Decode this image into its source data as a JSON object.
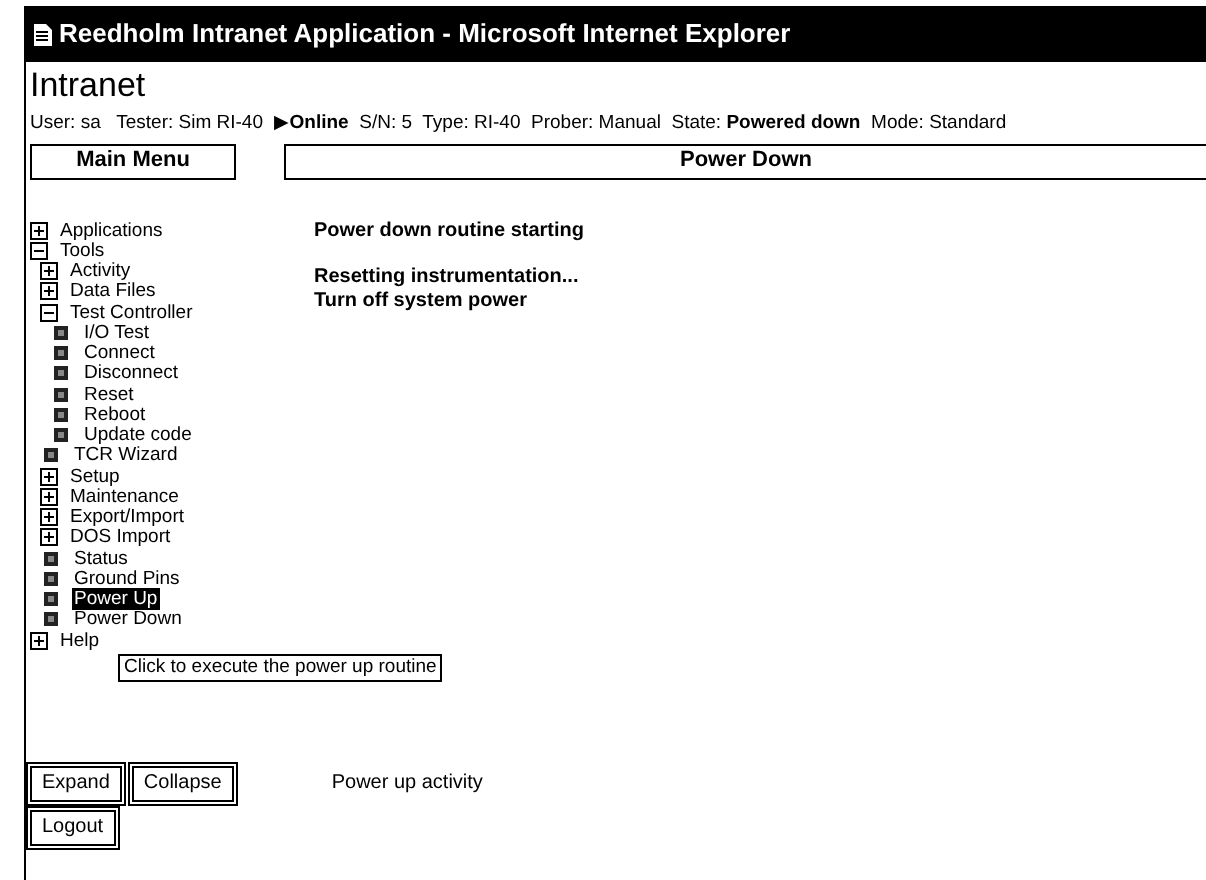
{
  "window": {
    "title": "Reedholm Intranet Application - Microsoft Internet Explorer"
  },
  "header": {
    "title": "Intranet",
    "info": "User: sa   Tester: Sim RI-40  ▶**Online**  S/N: 5  Type: RI-40  Prober: Manual  State: **Powered down**  Mode: Standard"
  },
  "menu_button": "Main Menu",
  "panel_title": "Power Down",
  "tree": [
    {
      "label": "Applications",
      "kind": "folder",
      "expanded": false,
      "selected": false
    },
    {
      "label": "Tools",
      "kind": "folder",
      "expanded": true,
      "selected": false,
      "children": [
        {
          "label": "Activity",
          "kind": "folder",
          "expanded": false,
          "selected": false
        },
        {
          "label": "Data Files",
          "kind": "folder",
          "expanded": false,
          "selected": false
        },
        {
          "label": "Test Controller",
          "kind": "folder",
          "expanded": true,
          "selected": false,
          "children": [
            {
              "label": "I/O Test",
              "kind": "leaf",
              "selected": false
            },
            {
              "label": "Connect",
              "kind": "leaf",
              "selected": false
            },
            {
              "label": "Disconnect",
              "kind": "leaf",
              "selected": false
            },
            {
              "label": "Reset",
              "kind": "leaf",
              "selected": false
            },
            {
              "label": "Reboot",
              "kind": "leaf",
              "selected": false
            },
            {
              "label": "Update code",
              "kind": "leaf",
              "selected": false
            }
          ]
        },
        {
          "label": "TCR Wizard",
          "kind": "leaf",
          "selected": false
        },
        {
          "label": "Setup",
          "kind": "folder",
          "expanded": false,
          "selected": false
        },
        {
          "label": "Maintenance",
          "kind": "folder",
          "expanded": false,
          "selected": false
        },
        {
          "label": "Export/Import",
          "kind": "folder",
          "expanded": false,
          "selected": false
        },
        {
          "label": "DOS Import",
          "kind": "folder",
          "expanded": false,
          "selected": false
        },
        {
          "label": "Status",
          "kind": "leaf",
          "selected": false
        },
        {
          "label": "Ground Pins",
          "kind": "leaf",
          "selected": false
        },
        {
          "label": "Power Up",
          "kind": "leaf",
          "selected": true
        },
        {
          "label": "Power Down",
          "kind": "leaf",
          "selected": false
        }
      ]
    },
    {
      "label": "Help",
      "kind": "folder",
      "expanded": false,
      "selected": false
    }
  ],
  "tooltip": "Click to execute the power up routine",
  "messages": [
    "Power down routine starting",
    "Resetting instrumentation...",
    "Turn off system power"
  ],
  "buttons": [
    "Expand",
    "Collapse"
  ],
  "status": "Power up activity",
  "logout": "Logout"
}
